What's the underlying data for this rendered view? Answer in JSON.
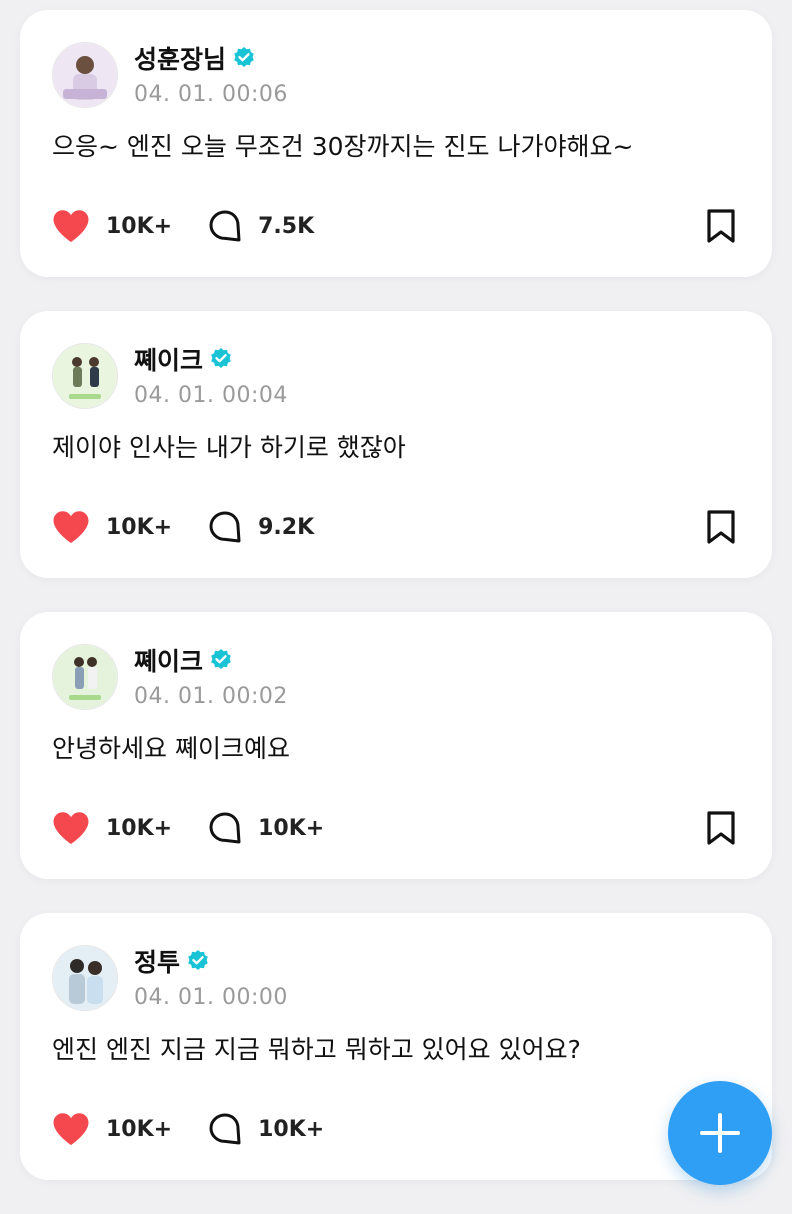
{
  "posts": [
    {
      "author": "성훈장님",
      "timestamp": "04. 01. 00:06",
      "content": "으응~ 엔진 오늘 무조건 30장까지는 진도 나가야해요~",
      "likes": "10K+",
      "comments": "7.5K"
    },
    {
      "author": "쪠이크",
      "timestamp": "04. 01. 00:04",
      "content": "제이야 인사는 내가 하기로 했잖아",
      "likes": "10K+",
      "comments": "9.2K"
    },
    {
      "author": "쪠이크",
      "timestamp": "04. 01. 00:02",
      "content": "안녕하세요 쪠이크예요",
      "likes": "10K+",
      "comments": "10K+"
    },
    {
      "author": "정투",
      "timestamp": "04. 01. 00:00",
      "content": "엔진 엔진 지금 지금 뭐하고 뭐하고 있어요 있어요?",
      "likes": "10K+",
      "comments": "10K+"
    }
  ],
  "colors": {
    "like": "#f5474e",
    "verified": "#19c3d6",
    "fab": "#2f9ef5"
  },
  "icons": {
    "like": "heart-icon",
    "comment": "speech-bubble-icon",
    "bookmark": "bookmark-icon",
    "verified": "verified-badge-icon",
    "fab": "plus-icon"
  }
}
